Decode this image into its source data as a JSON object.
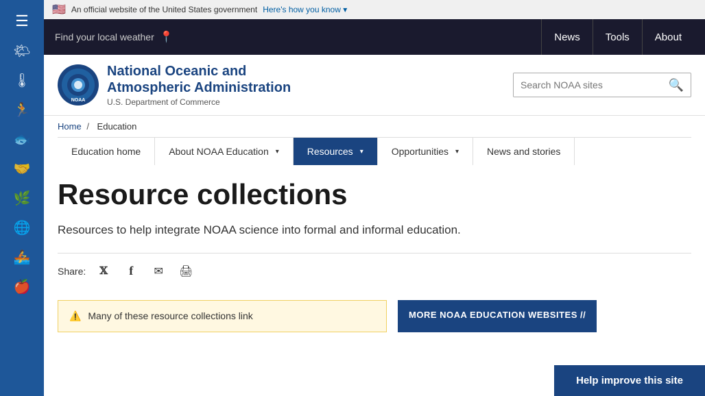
{
  "gov_banner": {
    "flag": "🇺🇸",
    "text": "An official website of the United States government",
    "link_text": "Here's how you know",
    "caret": "▾"
  },
  "header_bar": {
    "weather_label": "Find your local weather",
    "pin_icon": "📍",
    "nav": [
      {
        "label": "News",
        "id": "nav-news"
      },
      {
        "label": "Tools",
        "id": "nav-tools"
      },
      {
        "label": "About",
        "id": "nav-about"
      }
    ]
  },
  "sidebar": {
    "hamburger": "☰",
    "items": [
      {
        "icon": "🌤",
        "label": ""
      },
      {
        "icon": "🌡",
        "label": ""
      },
      {
        "icon": "🏃",
        "label": ""
      },
      {
        "icon": "🐟",
        "label": ""
      },
      {
        "icon": "🤝",
        "label": ""
      },
      {
        "icon": "🌿",
        "label": ""
      },
      {
        "icon": "🌐",
        "label": ""
      },
      {
        "icon": "🚣",
        "label": ""
      },
      {
        "icon": "🍎",
        "label": ""
      }
    ]
  },
  "noaa_header": {
    "org_name_line1": "National Oceanic and",
    "org_name_line2": "Atmospheric Administration",
    "dept": "U.S. Department of Commerce",
    "search_placeholder": "Search NOAA sites",
    "search_icon": "🔍"
  },
  "breadcrumb": {
    "home": "Home",
    "separator": "/",
    "current": "Education"
  },
  "subnav": {
    "items": [
      {
        "label": "Education home",
        "active": false,
        "has_caret": false
      },
      {
        "label": "About NOAA Education",
        "active": false,
        "has_caret": true
      },
      {
        "label": "Resources",
        "active": true,
        "has_caret": true
      },
      {
        "label": "Opportunities",
        "active": false,
        "has_caret": true
      },
      {
        "label": "News and stories",
        "active": false,
        "has_caret": false
      }
    ]
  },
  "page": {
    "title": "Resource collections",
    "description": "Resources to help integrate NOAA science into formal and informal education."
  },
  "share": {
    "label": "Share:",
    "twitter_icon": "𝕏",
    "facebook_icon": "f",
    "email_icon": "✉",
    "print_icon": "🖨"
  },
  "warning_card": {
    "icon": "⚠️",
    "text": "Many of these resource collections link"
  },
  "more_noaa": {
    "title": "MORE NOAA EDUCATION",
    "subtitle": "WEBSITES //"
  },
  "help_button": {
    "label": "Help improve this site"
  }
}
